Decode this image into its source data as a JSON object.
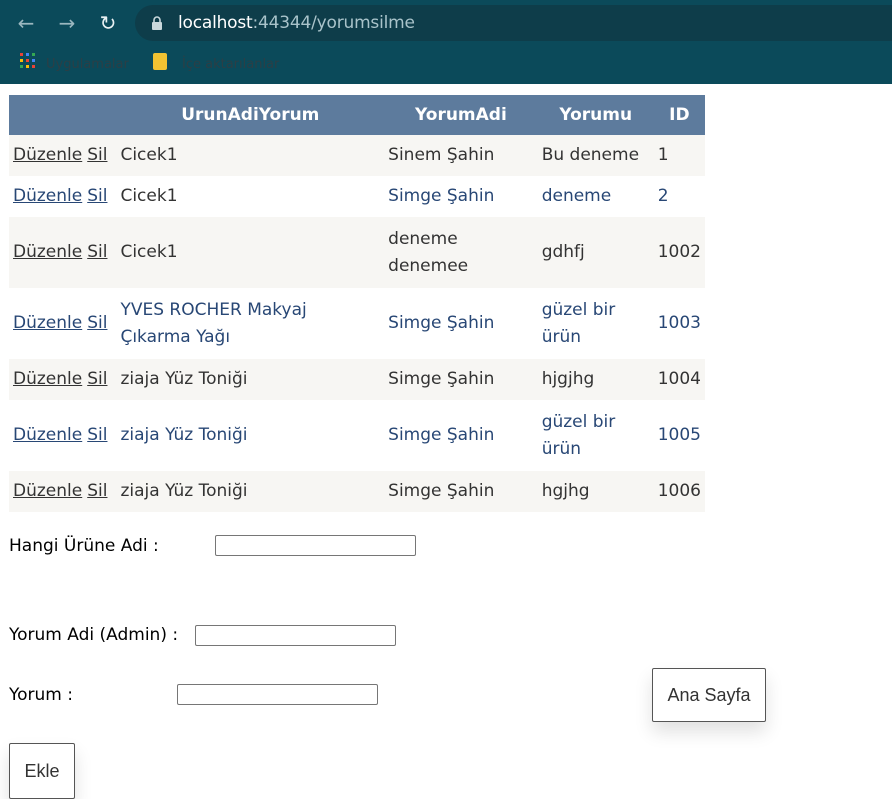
{
  "browser": {
    "url_host": "localhost",
    "url_path": ":44344/yorumsilme",
    "bookmarks": [
      {
        "label": "Uygulamalar"
      },
      {
        "label": "İçe aktarılanlar"
      }
    ]
  },
  "grid": {
    "headers": [
      "",
      "UrunAdiYorum",
      "YorumAdi",
      "Yorumu",
      "ID"
    ],
    "edit_label": "Düzenle",
    "delete_label": "Sil",
    "rows": [
      {
        "urun": "Cicek1",
        "yorum_adi": "Sinem Şahin",
        "yorumu": "Bu deneme",
        "id": "1"
      },
      {
        "urun": "Cicek1",
        "yorum_adi": "Simge Şahin",
        "yorumu": "deneme",
        "id": "2"
      },
      {
        "urun": "Cicek1",
        "yorum_adi": "deneme denemee",
        "yorumu": "gdhfj",
        "id": "1002"
      },
      {
        "urun": "YVES ROCHER Makyaj Çıkarma Yağı",
        "yorum_adi": "Simge Şahin",
        "yorumu": "güzel bir ürün",
        "id": "1003"
      },
      {
        "urun": "ziaja Yüz Toniği",
        "yorum_adi": "Simge Şahin",
        "yorumu": "hjgjhg",
        "id": "1004"
      },
      {
        "urun": "ziaja Yüz Toniği",
        "yorum_adi": "Simge Şahin",
        "yorumu": "güzel bir ürün",
        "id": "1005"
      },
      {
        "urun": "ziaja Yüz Toniği",
        "yorum_adi": "Simge Şahin",
        "yorumu": "hgjhg",
        "id": "1006"
      }
    ]
  },
  "form": {
    "urun_label": "Hangi Ürüne Adi :",
    "urun_value": "",
    "yorum_adi_label": "Yorum Adi (Admin) :",
    "yorum_adi_value": "",
    "yorum_label": "Yorum :",
    "yorum_value": "",
    "ekle_label": "Ekle",
    "ana_sayfa_label": "Ana Sayfa"
  },
  "colors": {
    "header_bg": "#5d7b9d",
    "odd_row_bg": "#f7f6f3",
    "even_row_text": "#284775",
    "chrome_bg": "#0b4a5a"
  }
}
